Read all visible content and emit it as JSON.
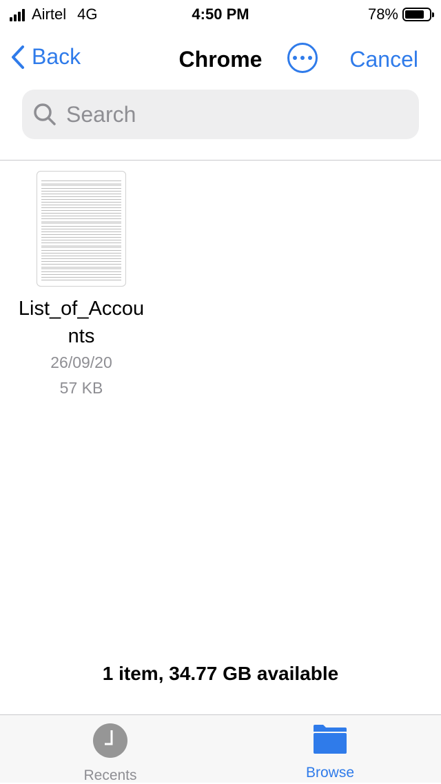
{
  "status": {
    "carrier": "Airtel",
    "network": "4G",
    "time": "4:50 PM",
    "battery": "78%",
    "battery_level": 0.78
  },
  "nav": {
    "back": "Back",
    "title": "Chrome",
    "more_icon": "ellipsis-circle-icon",
    "cancel": "Cancel"
  },
  "search": {
    "placeholder": "Search",
    "value": ""
  },
  "files": [
    {
      "name": "List_of_Accounts",
      "date": "26/09/20",
      "size": "57 KB"
    }
  ],
  "summary": "1 item, 34.77 GB available",
  "tabs": [
    {
      "label": "Recents",
      "icon": "clock-icon",
      "color": "#8e8e93"
    },
    {
      "label": "Browse",
      "icon": "folder-icon",
      "color": "#2f7bea",
      "active": true
    }
  ],
  "colors": {
    "accent": "#2f7bea"
  }
}
